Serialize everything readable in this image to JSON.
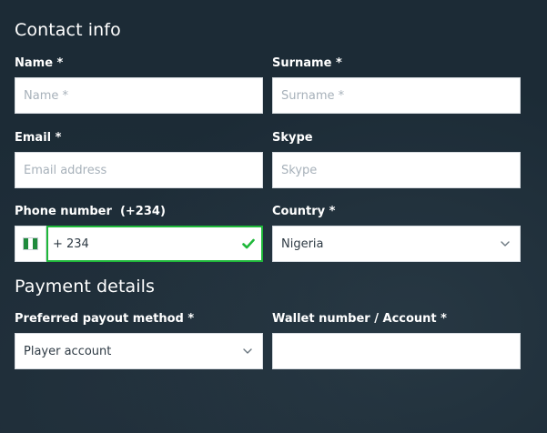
{
  "contact": {
    "title": "Contact info",
    "name": {
      "label": "Name *",
      "placeholder": "Name *"
    },
    "surname": {
      "label": "Surname *",
      "placeholder": "Surname *"
    },
    "email": {
      "label": "Email *",
      "placeholder": "Email address"
    },
    "skype": {
      "label": "Skype",
      "placeholder": "Skype"
    },
    "phone": {
      "label": "Phone number",
      "code_label": "(+234)",
      "prefix": "+",
      "value": "234",
      "valid_icon": "check-icon",
      "flag_icon": "nigeria-flag-icon",
      "valid_color": "#1fb83a"
    },
    "country": {
      "label": "Country *",
      "value": "Nigeria"
    }
  },
  "payment": {
    "title": "Payment details",
    "payout_method": {
      "label": "Preferred payout method *",
      "value": "Player account"
    },
    "wallet": {
      "label": "Wallet number / Account *",
      "placeholder": ""
    }
  }
}
